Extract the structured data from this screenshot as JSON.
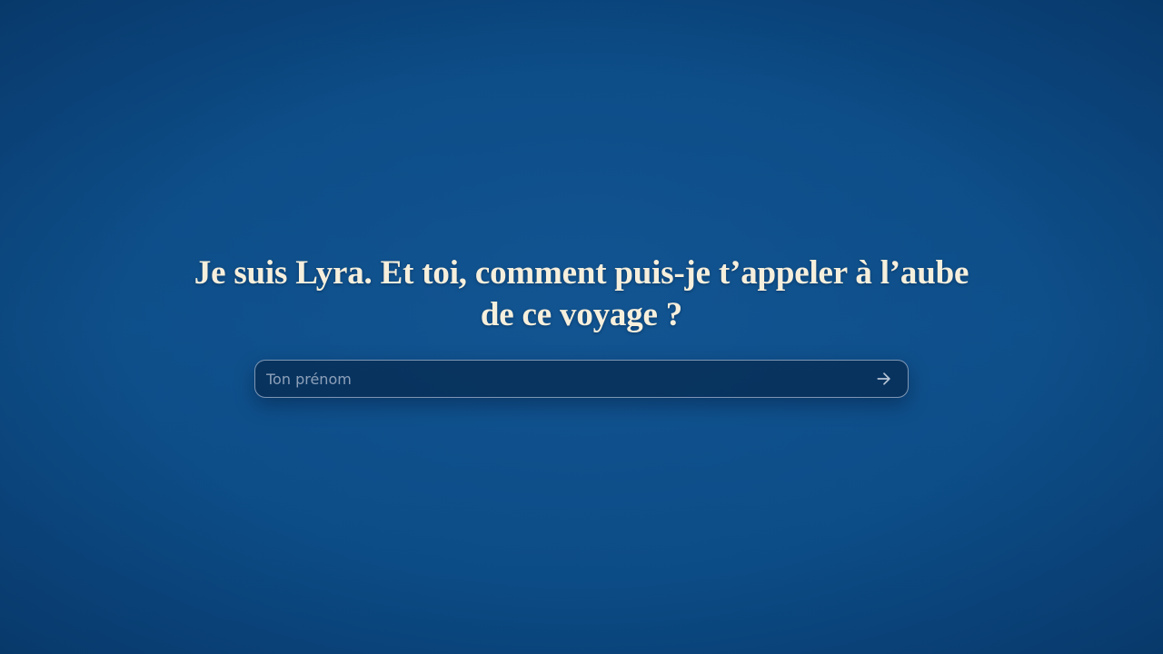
{
  "intro": {
    "prompt_text": "Je suis Lyra. Et toi, comment puis-je t’appeler à l’aube de ce voyage ?"
  },
  "name_form": {
    "input_value": "",
    "input_placeholder": "Ton prénom",
    "submit_icon": "arrow-right-icon"
  },
  "colors": {
    "background": "#0d4a83",
    "text": "#f6efdc",
    "input_border": "#bccde1",
    "icon": "#b9c6d7"
  }
}
